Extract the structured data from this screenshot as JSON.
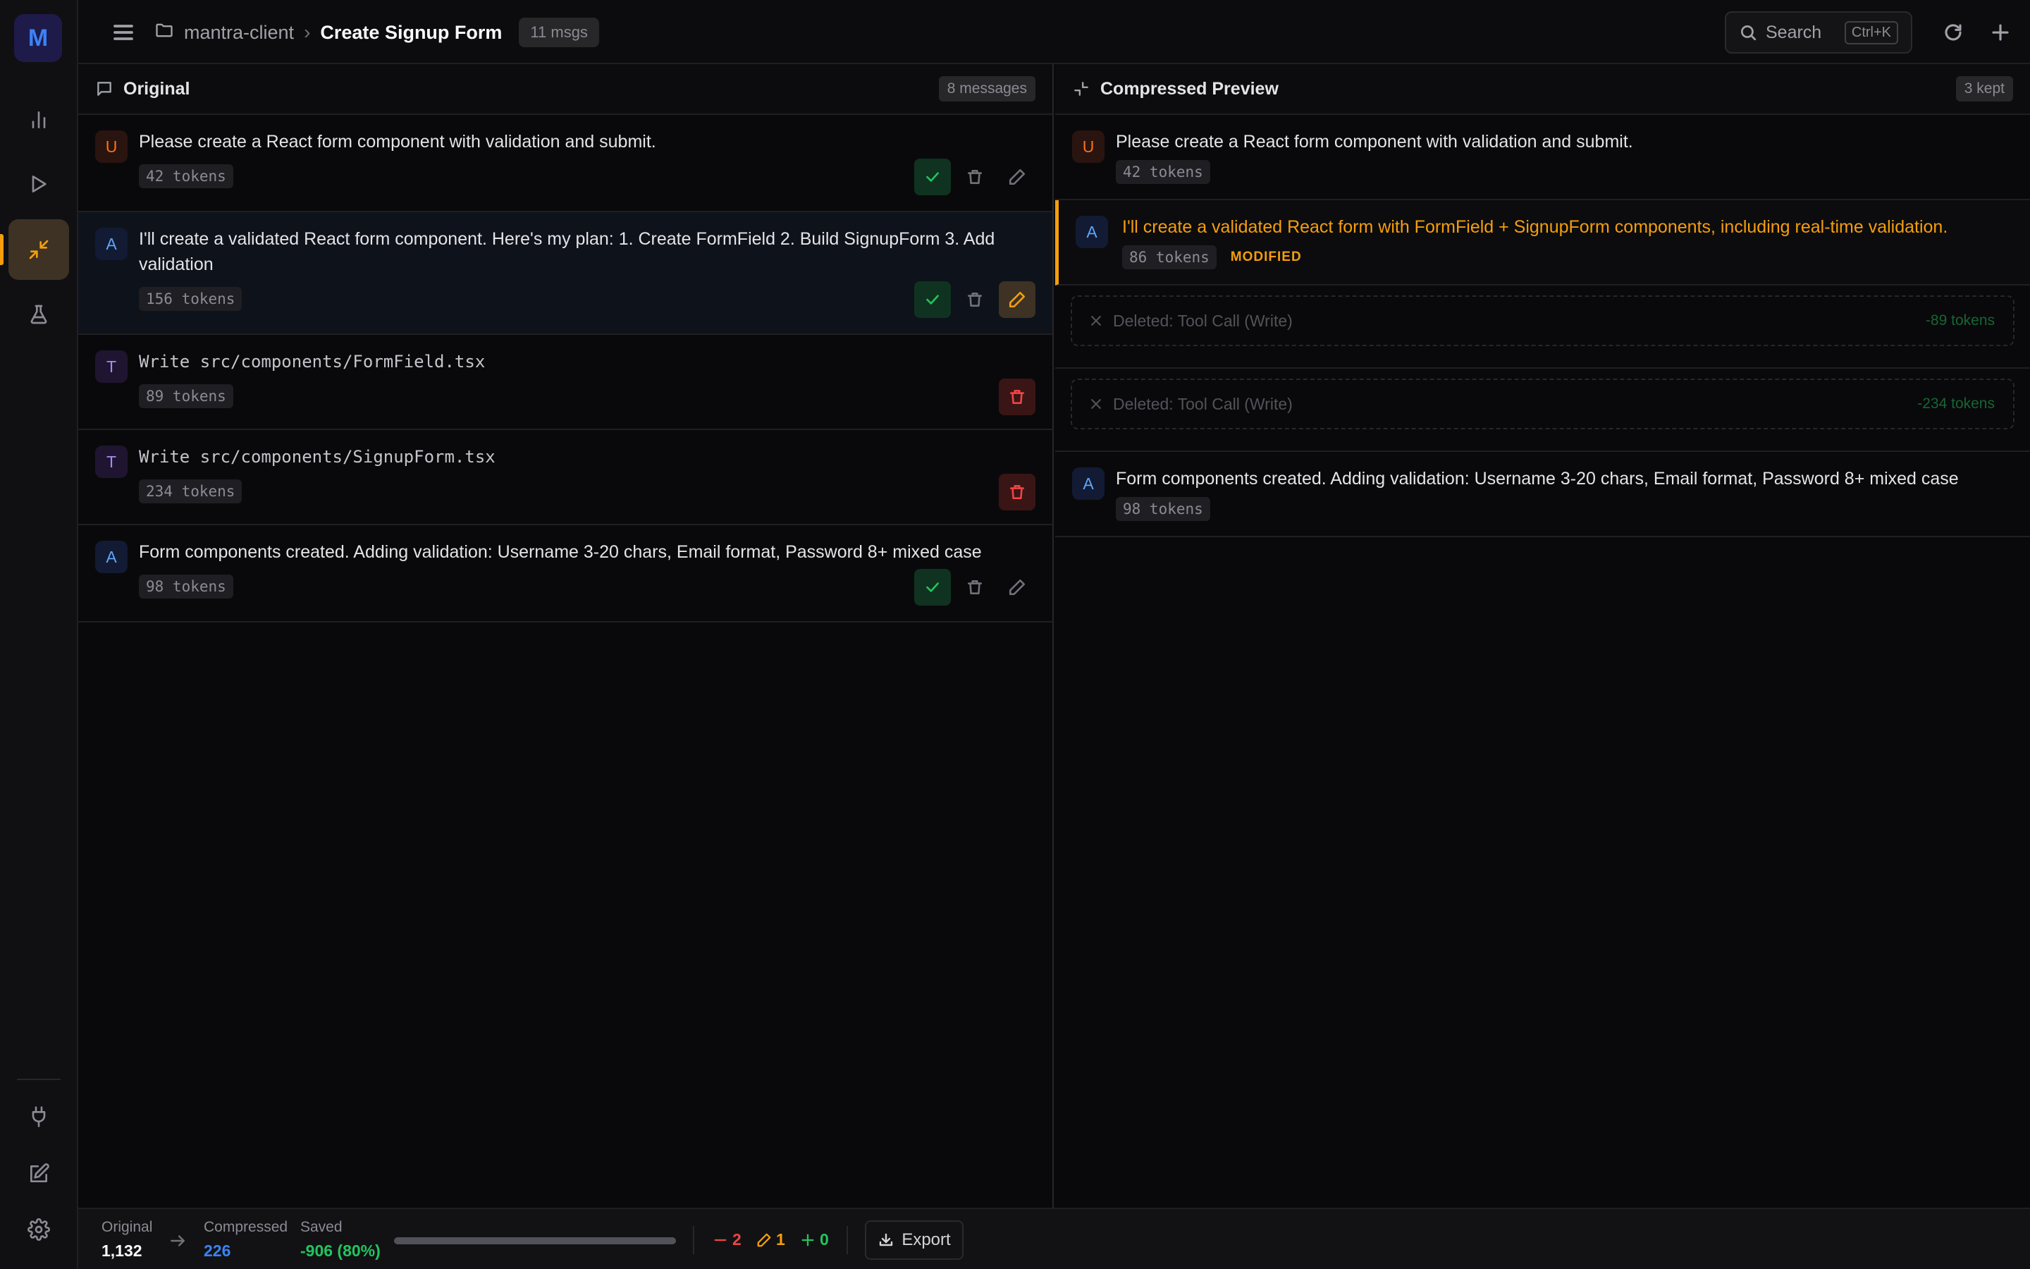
{
  "app": {
    "logo_letter": "M"
  },
  "header": {
    "project": "mantra-client",
    "title": "Create Signup Form",
    "badge": "11 msgs",
    "search_placeholder": "Search",
    "search_shortcut": "Ctrl+K"
  },
  "original": {
    "title": "Original",
    "count": "8 messages",
    "messages": [
      {
        "role": "U",
        "text": "Please create a React form component with validation and submit.",
        "tokens": "42 tokens"
      },
      {
        "role": "A",
        "text": "I'll create a validated React form component. Here's my plan: 1. Create FormField 2. Build SignupForm 3. Add validation",
        "tokens": "156 tokens"
      },
      {
        "role": "T",
        "text": "Write src/components/FormField.tsx",
        "tokens": "89 tokens"
      },
      {
        "role": "T",
        "text": "Write src/components/SignupForm.tsx",
        "tokens": "234 tokens"
      },
      {
        "role": "A",
        "text": "Form components created. Adding validation: Username 3-20 chars, Email format, Password 8+ mixed case",
        "tokens": "98 tokens"
      }
    ]
  },
  "compressed": {
    "title": "Compressed Preview",
    "count": "3 kept",
    "messages": [
      {
        "role": "U",
        "text": "Please create a React form component with validation and submit.",
        "tokens": "42 tokens"
      },
      {
        "role": "A",
        "text": "I'll create a validated React form with FormField + SignupForm components, including real-time validation.",
        "tokens": "86 tokens",
        "tag": "MODIFIED"
      },
      {
        "deleted_label": "Deleted: Tool Call (Write)",
        "deleted_tokens": "-89 tokens"
      },
      {
        "deleted_label": "Deleted: Tool Call (Write)",
        "deleted_tokens": "-234 tokens"
      },
      {
        "role": "A",
        "text": "Form components created. Adding validation: Username 3-20 chars, Email format, Password 8+ mixed case",
        "tokens": "98 tokens"
      }
    ]
  },
  "footer": {
    "original_label": "Original",
    "original_value": "1,132",
    "compressed_label": "Compressed",
    "compressed_value": "226",
    "saved_label": "Saved",
    "saved_value": "-906 (80%)",
    "progress_fraction": 1.0,
    "deleted_count": "2",
    "edited_count": "1",
    "added_count": "0",
    "export_label": "Export"
  },
  "colors": {
    "accent": "#f59e0b",
    "keep": "#22c55e",
    "delete": "#ef4444",
    "compressed_value": "#3b82f6",
    "saved_value": "#22c55e"
  }
}
